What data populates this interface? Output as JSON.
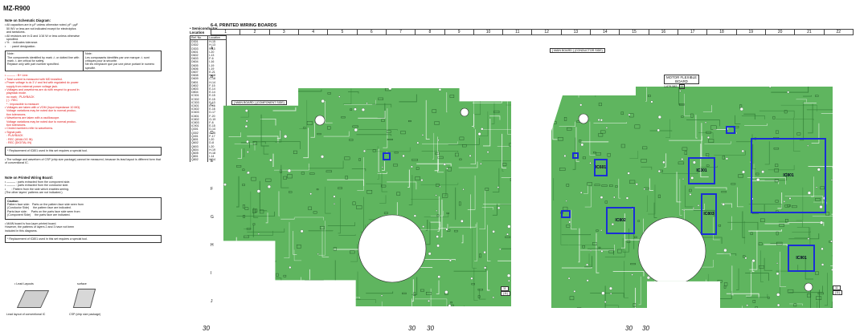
{
  "model": "MZ-R900",
  "section_title": "6-4.   PRINTED  WIRING  BOARDS",
  "columns": [
    "1",
    "2",
    "3",
    "4",
    "5",
    "6",
    "7",
    "8",
    "9",
    "10",
    "11",
    "12",
    "13",
    "14",
    "15",
    "16",
    "17",
    "18",
    "19",
    "20",
    "21",
    "22"
  ],
  "rows": [
    "A",
    "B",
    "C",
    "D",
    "E",
    "F",
    "G",
    "H",
    "I",
    "J"
  ],
  "notes_schematic": {
    "heading": "Note on Schematic Diagram:",
    "lines": [
      "• All capacitors are in μF unless otherwise noted. pF: μμF",
      "  50 WV or less are not indicated except for electrolytics",
      "  and tantalums.",
      "• All resistors are in Ω and 1/16 W or less unless otherwise",
      "  specified.",
      "• %   : indicates tolerance.",
      "•      : panel designation."
    ],
    "note_left": "Note:\nThe components identified by mark ⚠ or dotted line with mark ⚠ are critical for safety.\nReplace only with part number specified.",
    "note_right": "Note:\nLes composants identifiés par une marque ⚠ sont critiques pour la sécurité.\nNe les remplacer que par une pièce portant le numéro spécifié.",
    "red_lines": [
      "• ——— : B+ Line.",
      "• Total current is measured with MD installed.",
      "• Power voltage is dc 3 V and fed with regulated dc power",
      "  supply from external power voltage jack.",
      "• Voltages and waveforms are dc with respect to ground in",
      "  playback mode.",
      "  no mark : PLAYBACK",
      "  ( ) : REC",
      "  * : Impossible to measure",
      "• Voltages are taken with a VOM (Input impedance 10 MΩ).",
      "  Voltage variations may be noted due to normal produc-",
      "  tion tolerances.",
      "• Waveforms are taken with a oscilloscope.",
      "  Voltage variations may be noted due to normal produc-",
      "  tion tolerances.",
      "• Circled numbers refer to waveforms.",
      "• Signal path.",
      "  : PLAYBACK",
      "  : REC (ANALOG IN)",
      "  : REC (DIGITAL IN)"
    ],
    "replacement_note": "* Replacement of IC801 used in this set requires a special tool.",
    "csp_note": "• The voltage and waveform of CSP (chip size package) cannot be measured, because its lead layout is different form that of conventional IC."
  },
  "notes_board": {
    "heading": "Note on Printed Wiring Board:",
    "lines": [
      "• ——— : parts extracted from the component side.",
      "• ——— : parts extracted from the conductor side.",
      "•       : Pattern from the side which enables seeing.",
      "(The other layers' patterns are not indicated.)"
    ],
    "caution_title": "Caution:",
    "caution_lines": [
      "Pattern face side:   Parts on the pattern face side seen from",
      "(Conductor Side)     the pattern face are indicated.",
      "Parts face side:     Parts on the parts face side seen from",
      "(Component Side)     the parts face are indicated."
    ],
    "main_board_note": "• MAIN board is four-layer printed board.\n  However, the patterns of layers 2 and 3 have not been\n  included in this diagrams.",
    "replacement_note": "* Replacement of IC801 used in this set requires a special tool.",
    "lead_layouts": "• Lead Layouts",
    "surface": "surface",
    "cap_conventional": "Lead layout of conventional IC",
    "cap_csp": "CSP (chip size package)"
  },
  "semiconductor": {
    "heading": "• Semiconductor\n  Location",
    "col_ref": "Ref. No.",
    "col_loc": "Location",
    "rows": [
      [
        "D301",
        "H-15"
      ],
      [
        "D302",
        "H-13"
      ],
      [
        "D303",
        "F-13"
      ],
      [
        "D601",
        "I-20"
      ],
      [
        "D602",
        "I-13"
      ],
      [
        "D603",
        "F-6"
      ],
      [
        "D604",
        "I-16"
      ],
      [
        "D605",
        "I-19"
      ],
      [
        "D606",
        "I-19"
      ],
      [
        "D607",
        "E-21"
      ],
      [
        "D608",
        "H-18"
      ],
      [
        "D609",
        "C-18"
      ],
      [
        "D801",
        "H-14"
      ],
      [
        "D802",
        "F-15"
      ],
      [
        "D803",
        "E-14"
      ],
      [
        "D804",
        "E-14"
      ],
      [
        "IC301",
        "E-15"
      ],
      [
        "IC302",
        "E-15"
      ],
      [
        "IC303",
        "E-13"
      ],
      [
        "IC601",
        "E-16"
      ],
      [
        "IC602",
        "E-16"
      ],
      [
        "IC603",
        "D-17"
      ],
      [
        "IC801",
        "F-20"
      ],
      [
        "IC802",
        "G-19"
      ],
      [
        "IC803",
        "F-8"
      ],
      [
        "IC901",
        "E-15"
      ],
      [
        "Q301",
        "D-14"
      ],
      [
        "Q302",
        "C-15"
      ],
      [
        "Q401",
        "F-17"
      ],
      [
        "Q601",
        "I-20"
      ],
      [
        "Q602",
        "D-8"
      ],
      [
        "Q603",
        "I-20"
      ],
      [
        "Q604",
        "H-19"
      ],
      [
        "Q605",
        "H-18"
      ],
      [
        "Q801",
        "I-14"
      ],
      [
        "Q802",
        "H-14"
      ]
    ]
  },
  "board_labels": {
    "main_board_component": "[ MAIN BOARD ] (COMPONENT SIDE)",
    "main_board_conductor": "[ MAIN BOARD ] (CONDUCTOR SIDE)",
    "motor_flexible": "MOTOR FLEXIBLE\nBOARD",
    "flex_code": "1-679-582-",
    "flex_code_suffix": "11",
    "ic_labels": [
      "IC501",
      "IC601",
      "IC301",
      "IC802",
      "IC801",
      "IC803",
      "IC901"
    ],
    "small_tag_11": "11",
    "small_tag_11b": "(11)",
    "small_tag_right": "11",
    "small_tag_right_b": "(11)"
  },
  "page_numbers": [
    "30",
    "30",
    "30",
    "30",
    "30"
  ],
  "colors": {
    "board_green": "#5fb55f",
    "trace_dark": "#2e7a33",
    "ic_blue": "#1a2fd6",
    "note_red": "#dd1111"
  }
}
